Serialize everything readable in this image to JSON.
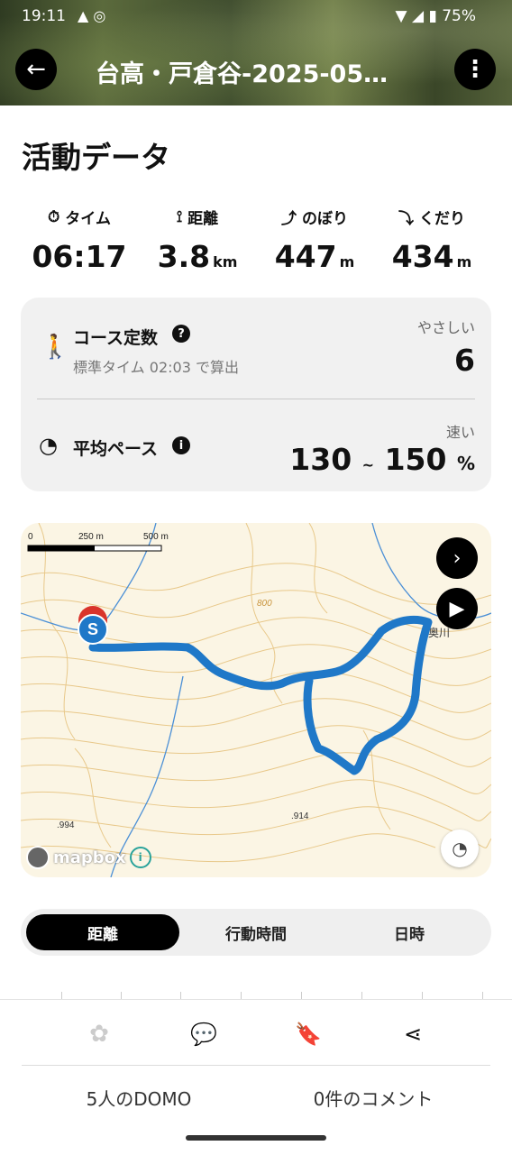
{
  "status": {
    "time": "19:11",
    "battery": "75%"
  },
  "header": {
    "title": "台高・戸倉谷-2025-05…"
  },
  "section_title": "活動データ",
  "stats": [
    {
      "label": "タイム",
      "value": "06:17",
      "unit": "",
      "icon": "stopwatch-icon"
    },
    {
      "label": "距離",
      "value": "3.8",
      "unit": "km",
      "icon": "route-icon"
    },
    {
      "label": "のぼり",
      "value": "447",
      "unit": "m",
      "icon": "ascent-icon"
    },
    {
      "label": "くだり",
      "value": "434",
      "unit": "m",
      "icon": "descent-icon"
    }
  ],
  "course": {
    "label": "コース定数",
    "sub": "標準タイム 02:03 で算出",
    "tag": "やさしい",
    "value": "6"
  },
  "pace": {
    "label": "平均ペース",
    "tag": "速い",
    "from": "130",
    "sep": "~",
    "to": "150",
    "unit": "%"
  },
  "map": {
    "scale": {
      "zero": "0",
      "mid": "250 m",
      "end": "500 m"
    },
    "labels": {
      "contour_800": "800",
      "peak_994": ".994",
      "peak_914": ".914",
      "place": "奥川"
    },
    "start_marker": "S",
    "attribution": "mapbox",
    "info": "i"
  },
  "segments": {
    "items": [
      "距離",
      "行動時間",
      "日時"
    ],
    "active": 0
  },
  "bottom": {
    "domo": "5人のDOMO",
    "comments": "0件のコメント"
  },
  "colors": {
    "track": "#1f78c8",
    "accent": "#000000",
    "map_bg": "#fbf5e4",
    "contour": "#d9a441"
  }
}
